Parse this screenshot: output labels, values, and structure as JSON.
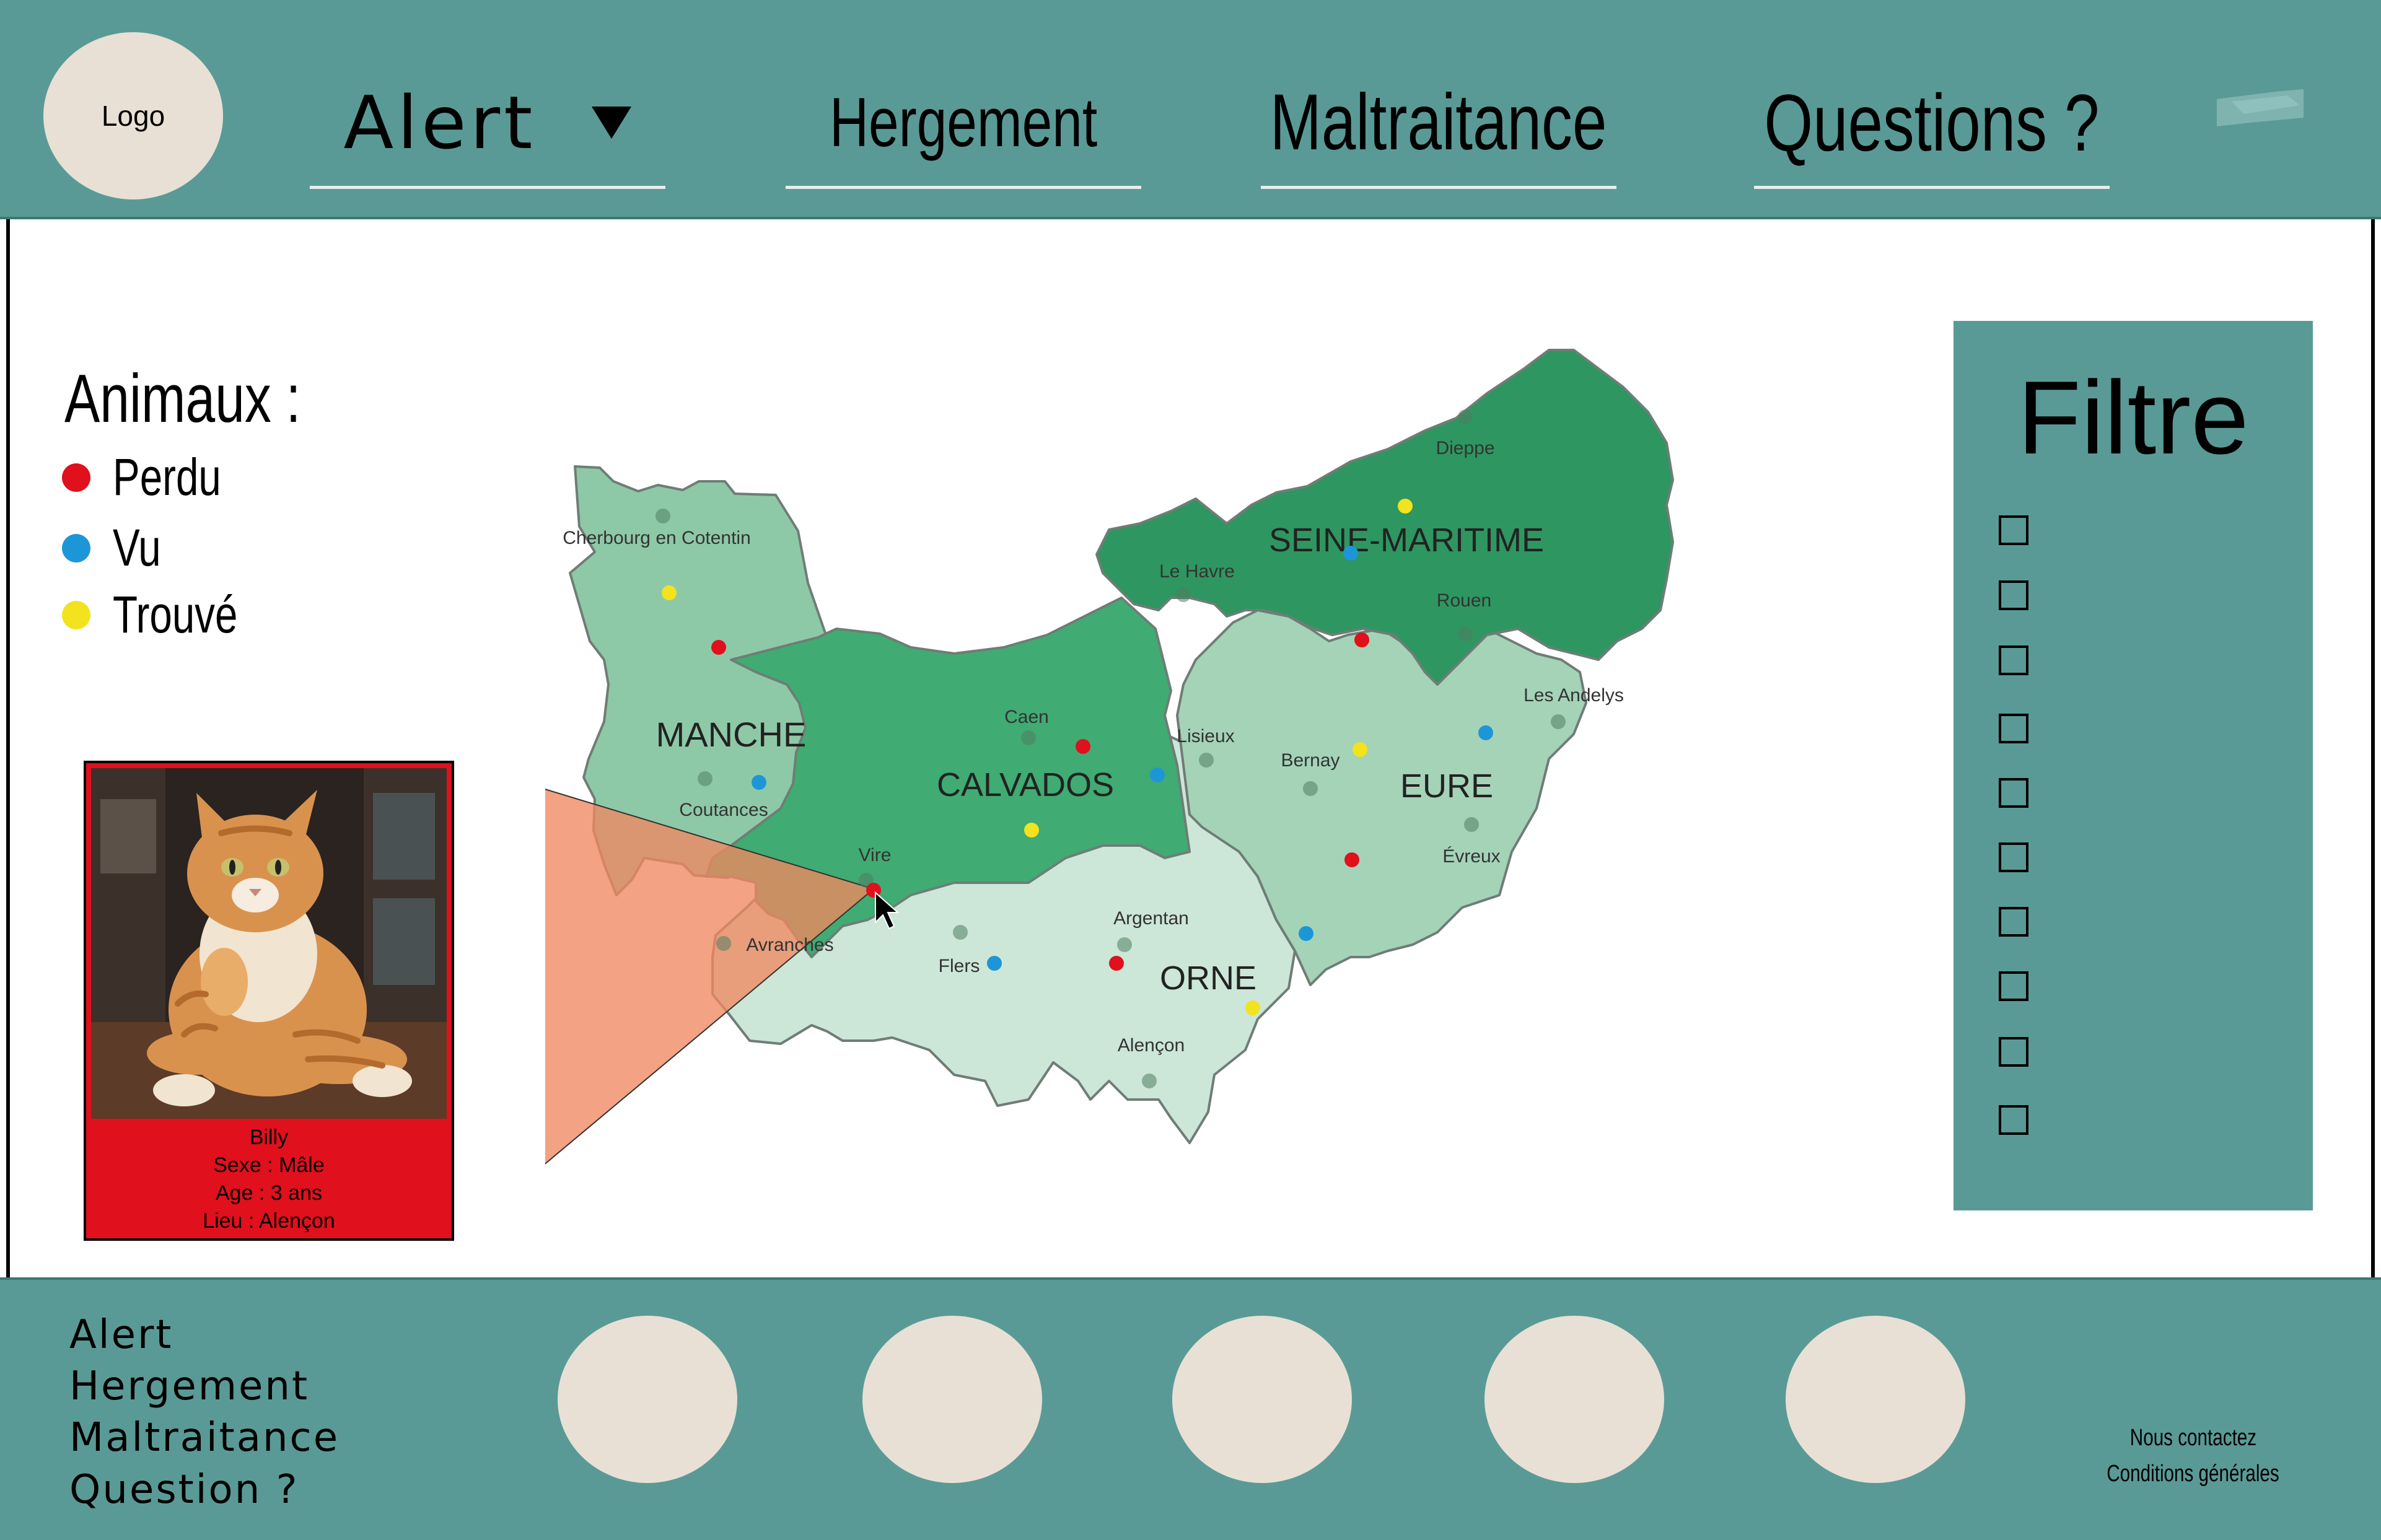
{
  "header": {
    "logo_text": "Logo",
    "nav": {
      "alert": "Alert",
      "hergement": "Hergement",
      "maltraitance": "Maltraitance",
      "questions": "Questions ?"
    }
  },
  "legend": {
    "title": "Animaux :",
    "items": [
      {
        "label": "Perdu",
        "color": "#e0101c"
      },
      {
        "label": "Vu",
        "color": "#1d96d8"
      },
      {
        "label": "Trouvé",
        "color": "#f3e21e"
      }
    ]
  },
  "map": {
    "regions": {
      "manche": "MANCHE",
      "calvados": "CALVADOS",
      "seine_maritime": "SEINE-MARITIME",
      "eure": "EURE",
      "orne": "ORNE"
    },
    "cities": {
      "cherbourg": "Cherbourg en Cotentin",
      "coutances": "Coutances",
      "avranches": "Avranches",
      "vire": "Vire",
      "caen": "Caen",
      "lisieux": "Lisieux",
      "le_havre": "Le Havre",
      "dieppe": "Dieppe",
      "rouen": "Rouen",
      "les_andelys": "Les Andelys",
      "bernay": "Bernay",
      "evreux": "Évreux",
      "argentan": "Argentan",
      "flers": "Flers",
      "alencon": "Alençon"
    },
    "region_colors": {
      "manche": "#8ec9a7",
      "calvados": "#40ab72",
      "seine_maritime": "#2e9660",
      "eure": "#a4d3b8",
      "orne": "#cce6d8"
    }
  },
  "animal_card": {
    "name": "Billy",
    "sex": "Sexe : Mâle",
    "age": "Age : 3 ans",
    "place": "Lieu : Alençon"
  },
  "filter": {
    "title": "Filtre",
    "checkbox_count": 10
  },
  "footer": {
    "links": {
      "alert": "Alert",
      "hergement": "Hergement",
      "maltraitance": "Maltraitance",
      "question": "Question ?"
    },
    "contact": "Nous contactez",
    "terms": "Conditions générales"
  },
  "colors": {
    "teal": "#5a9a96",
    "beige": "#e8e0d5",
    "red": "#e0101c"
  }
}
